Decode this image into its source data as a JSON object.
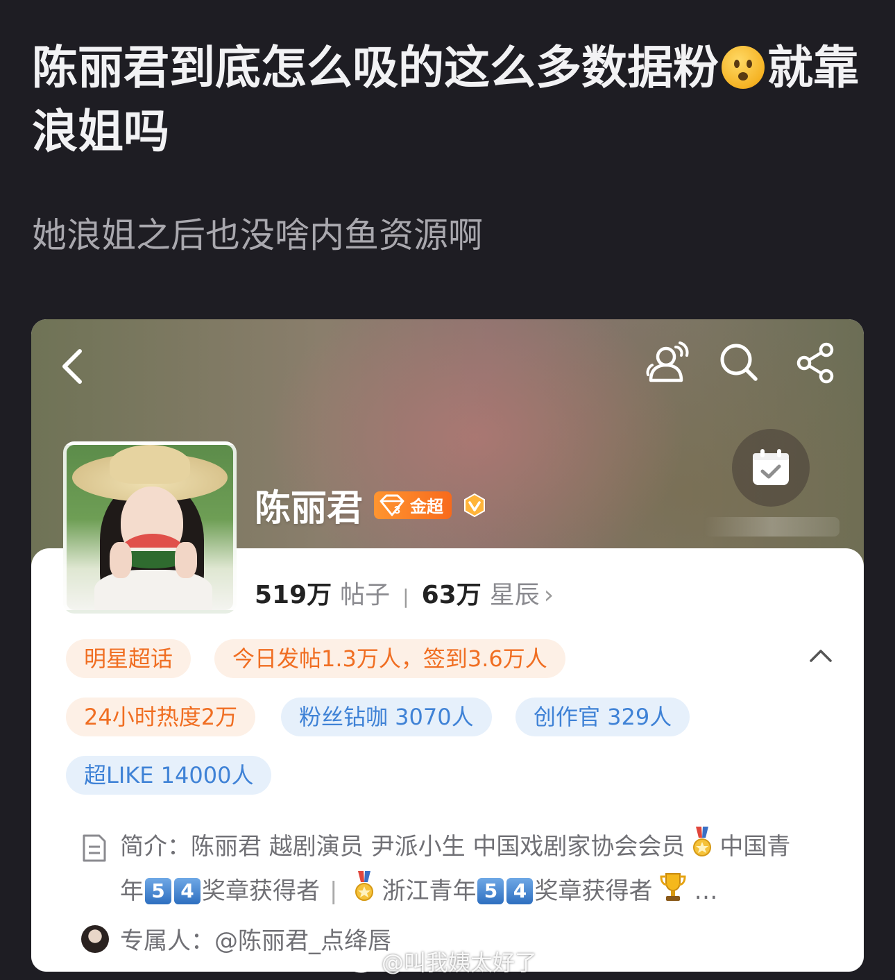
{
  "post": {
    "title_part1": "陈丽君到底怎么吸的这么多数据粉",
    "title_emoji": "worried-face-emoji",
    "title_part2": "就靠浪姐吗",
    "subtitle": "她浪姐之后也没啥内鱼资源啊"
  },
  "header": {
    "icons": [
      "back-icon",
      "people-icon",
      "search-icon",
      "share-icon"
    ]
  },
  "profile": {
    "name": "陈丽君",
    "level_number": "3",
    "level_label": "金超",
    "verified_icon": "v-badge-icon",
    "checkin_icon": "calendar-check-icon",
    "posts_count": "519万",
    "posts_label": "帖子",
    "stars_count": "63万",
    "stars_label": "星辰",
    "stars_chevron": "›"
  },
  "tags": {
    "category": "明星超话",
    "today": "今日发帖1.3万人，签到3.6万人",
    "heat": "24小时热度2万",
    "diamond": "粉丝钻咖 3070人",
    "creator": "创作官 329人",
    "super_like": "超LIKE 14000人"
  },
  "intro": {
    "label": "简介：",
    "text_a": "陈丽君 越剧演员 尹派小生 中国戏剧家协会会员",
    "text_b": "中国青年",
    "chip_1": "5",
    "chip_2": "4",
    "text_c": "奖章获得者",
    "separator": "|",
    "text_d": "浙江青年",
    "chip_3": "5",
    "chip_4": "4",
    "text_e": "奖章获得者",
    "ellipsis": "…"
  },
  "owner": {
    "label": "专属人：",
    "handle": "@陈丽君_点绛唇"
  },
  "watermark": {
    "text": "@叫我姨太好了"
  },
  "colors": {
    "page_bg": "#1e1d23",
    "orange_accent": "#f06e22",
    "blue_accent": "#3f82d6",
    "level_badge": "#f76a1c"
  }
}
